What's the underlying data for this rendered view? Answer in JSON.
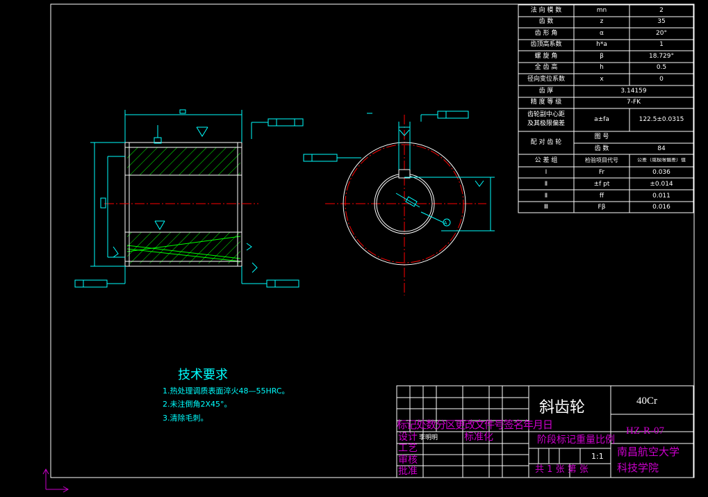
{
  "param_table": {
    "rows": [
      {
        "name": "法 向 模 数",
        "symbol": "mn",
        "value": "2"
      },
      {
        "name": "齿      数",
        "symbol": "z",
        "value": "35"
      },
      {
        "name": "齿 形 角",
        "symbol": "α",
        "value": "20°"
      },
      {
        "name": "齿顶高系数",
        "symbol": "h*a",
        "value": "1"
      },
      {
        "name": "螺 旋 角",
        "symbol": "β",
        "value": "18.729°"
      },
      {
        "name": "全 齿 高",
        "symbol": "h",
        "value": "0.5"
      },
      {
        "name": "径向变位系数",
        "symbol": "x",
        "value": "0"
      },
      {
        "name": "齿      厚",
        "symbol": "",
        "value": "3.14159"
      },
      {
        "name": "精 度 等 级",
        "symbol": "",
        "value": "7-FK"
      }
    ],
    "center_distance": {
      "name_line1": "齿轮副中心距",
      "name_line2": "及其极限偏差",
      "symbol": "a±fa",
      "value": "122.5±0.0315"
    },
    "mating_gear": {
      "label": "配 对 齿 轮",
      "fig_no_label": "图      号",
      "fig_no_value": "",
      "teeth_label": "齿      数",
      "teeth_value": "84"
    },
    "tolerance_header": {
      "group": "公   差   组",
      "item": "检验项目代号",
      "tol": "公差（或极限偏差）值"
    },
    "tolerance_rows": [
      {
        "group": "Ⅰ",
        "item": "Fr",
        "value": "0.036"
      },
      {
        "group": "Ⅱ",
        "item": "±f pt",
        "value": "±0.014"
      },
      {
        "group": "Ⅱ",
        "item": "ff",
        "value": "0.011"
      },
      {
        "group": "Ⅲ",
        "item": "Fβ",
        "value": "0.016"
      }
    ]
  },
  "tech_requirements": {
    "title": "技术要求",
    "items": [
      "1.热处理调质表面淬火48—55HRC。",
      "2.未注倒角2X45°。",
      "3.清除毛刺。"
    ]
  },
  "title_block": {
    "part_name": "斜齿轮",
    "material": "40Cr",
    "drawing_no": "HZ-R-07",
    "school_line1": "南昌航空大学",
    "school_line2": "科技学院",
    "revision_header": "标记处数分区更改文件号签名年月日",
    "design_label": "设计",
    "designer": "李明明",
    "standardize_label": "标准化",
    "process_label": "工艺",
    "review_label": "审核",
    "approve_label": "批准",
    "stage_header": "阶段标记重量比例",
    "scale": "1:1",
    "sheets_label": "共  1  张 第  张"
  },
  "colors": {
    "background": "#000000",
    "frame": "#ffffff",
    "hatch": "#00ff00",
    "center_line": "#ff0000",
    "dimension": "#00ffff",
    "title_text": "#cc00cc"
  }
}
